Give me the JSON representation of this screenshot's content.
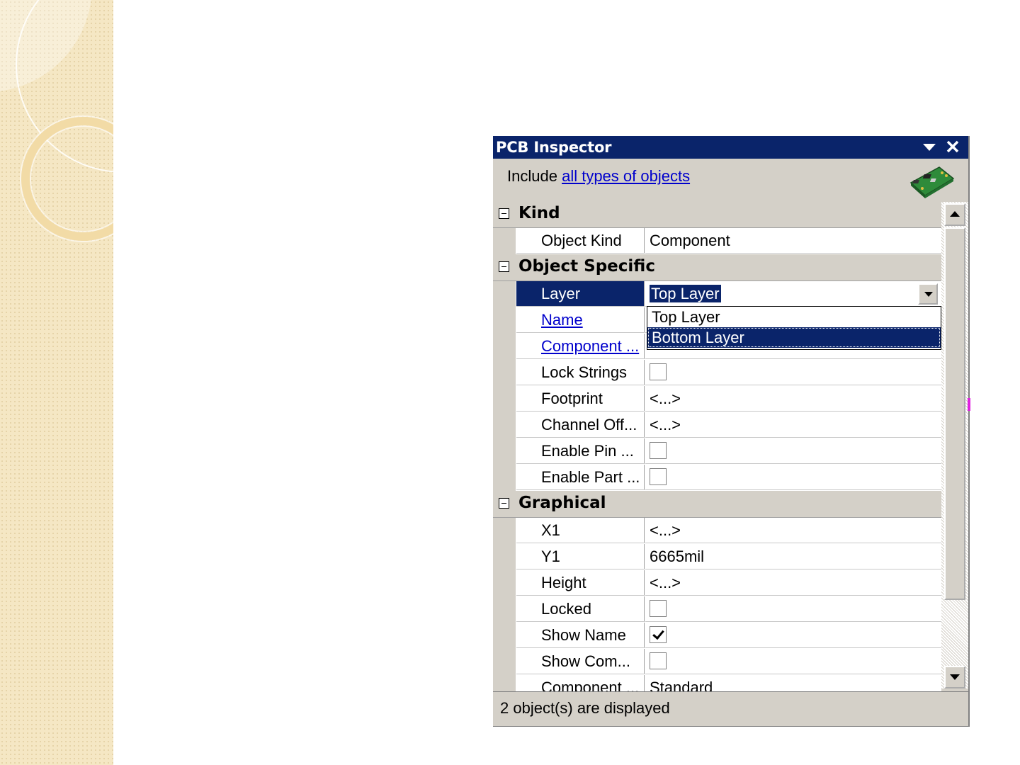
{
  "panel": {
    "title": "PCB Inspector",
    "include_prefix": "Include",
    "include_link": "all types of objects",
    "status": "2 object(s) are displayed"
  },
  "categories": {
    "kind": "Kind",
    "object_specific": "Object Specific",
    "graphical": "Graphical"
  },
  "rows": {
    "object_kind": {
      "name": "Object Kind",
      "value": "Component"
    },
    "layer": {
      "name": "Layer",
      "value": "Top Layer"
    },
    "name": {
      "name": "Name",
      "value": ""
    },
    "component": {
      "name": "Component ...",
      "value": ""
    },
    "lock_strings": {
      "name": "Lock Strings",
      "checked": false
    },
    "footprint": {
      "name": "Footprint",
      "value": "<...>"
    },
    "channel_off": {
      "name": "Channel Off...",
      "value": "<...>"
    },
    "enable_pin": {
      "name": "Enable Pin ...",
      "checked": false
    },
    "enable_part": {
      "name": "Enable Part ...",
      "checked": false
    },
    "x1": {
      "name": "X1",
      "value": "<...>"
    },
    "y1": {
      "name": "Y1",
      "value": "6665mil"
    },
    "height": {
      "name": "Height",
      "value": "<...>"
    },
    "locked": {
      "name": "Locked",
      "checked": false
    },
    "show_name": {
      "name": "Show Name",
      "checked": true
    },
    "show_com": {
      "name": "Show Com...",
      "checked": false
    },
    "component2": {
      "name": "Component ...",
      "value": "Standard"
    }
  },
  "dropdown": {
    "options": [
      "Top Layer",
      "Bottom Layer"
    ],
    "highlighted": "Bottom Layer"
  },
  "icons": {
    "menu": "chevron-down-icon",
    "close": "close-icon",
    "board": "pcb-board-icon"
  },
  "colors": {
    "titlebar": "#0a246a",
    "panel_bg": "#d4d0c8",
    "link": "#0000cc"
  }
}
